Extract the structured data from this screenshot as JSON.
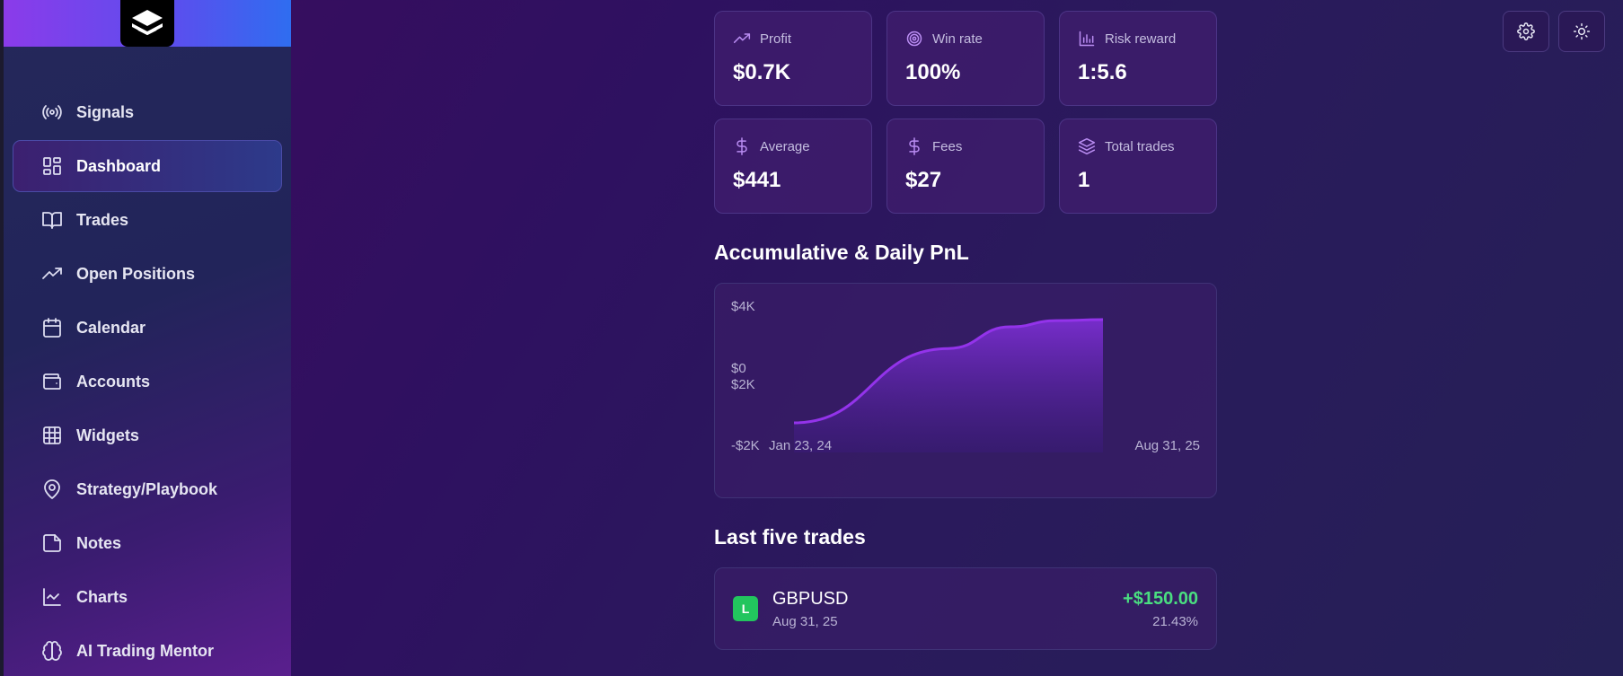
{
  "sidebar": {
    "items": [
      {
        "label": "Signals",
        "icon": "broadcast-icon",
        "active": false
      },
      {
        "label": "Dashboard",
        "icon": "layout-dashboard-icon",
        "active": true
      },
      {
        "label": "Trades",
        "icon": "open-book-icon",
        "active": false
      },
      {
        "label": "Open Positions",
        "icon": "trending-up-icon",
        "active": false
      },
      {
        "label": "Calendar",
        "icon": "calendar-icon",
        "active": false
      },
      {
        "label": "Accounts",
        "icon": "wallet-icon",
        "active": false
      },
      {
        "label": "Widgets",
        "icon": "grid-icon",
        "active": false
      },
      {
        "label": "Strategy/Playbook",
        "icon": "map-pin-icon",
        "active": false
      },
      {
        "label": "Notes",
        "icon": "note-icon",
        "active": false
      },
      {
        "label": "Charts",
        "icon": "line-chart-icon",
        "active": false
      },
      {
        "label": "AI Trading Mentor",
        "icon": "brain-icon",
        "active": false
      }
    ]
  },
  "stats": [
    {
      "label": "Profit",
      "value": "$0.7K",
      "icon": "trending-up-icon"
    },
    {
      "label": "Win rate",
      "value": "100%",
      "icon": "target-icon"
    },
    {
      "label": "Risk reward",
      "value": "1:5.6",
      "icon": "bar-chart-icon"
    },
    {
      "label": "Average",
      "value": "$441",
      "icon": "dollar-icon"
    },
    {
      "label": "Fees",
      "value": "$27",
      "icon": "dollar-icon"
    },
    {
      "label": "Total trades",
      "value": "1",
      "icon": "layers-icon"
    }
  ],
  "chart_section": {
    "title": "Accumulative & Daily PnL"
  },
  "chart_data": {
    "type": "area",
    "title": "Accumulative & Daily PnL",
    "y_tick_labels": [
      "$4K",
      "$0",
      "$2K",
      "-$2K"
    ],
    "x_tick_labels": [
      "Jan 23, 24",
      "Aug 31, 25"
    ],
    "series": [
      {
        "points": [
          [
            0,
            0.0
          ],
          [
            0.5,
            0.72
          ],
          [
            0.7,
            0.93
          ],
          [
            0.85,
            0.99
          ],
          [
            1.0,
            1.0
          ]
        ]
      }
    ],
    "colors": {
      "line": "#9333ea",
      "fill_top": "#7e2fd6",
      "fill_bottom": "#3a1a7a"
    }
  },
  "trades_section": {
    "title": "Last five trades"
  },
  "trades": [
    {
      "badge": "L",
      "symbol": "GBPUSD",
      "date": "Aug 31, 25",
      "pnl": "+$150.00",
      "pct": "21.43%"
    }
  ],
  "top_actions": {
    "settings_icon": "gear-icon",
    "theme_icon": "sun-icon"
  },
  "colors": {
    "accent": "#8b3bea",
    "positive": "#4ade80",
    "badge_long": "#22c55e"
  }
}
